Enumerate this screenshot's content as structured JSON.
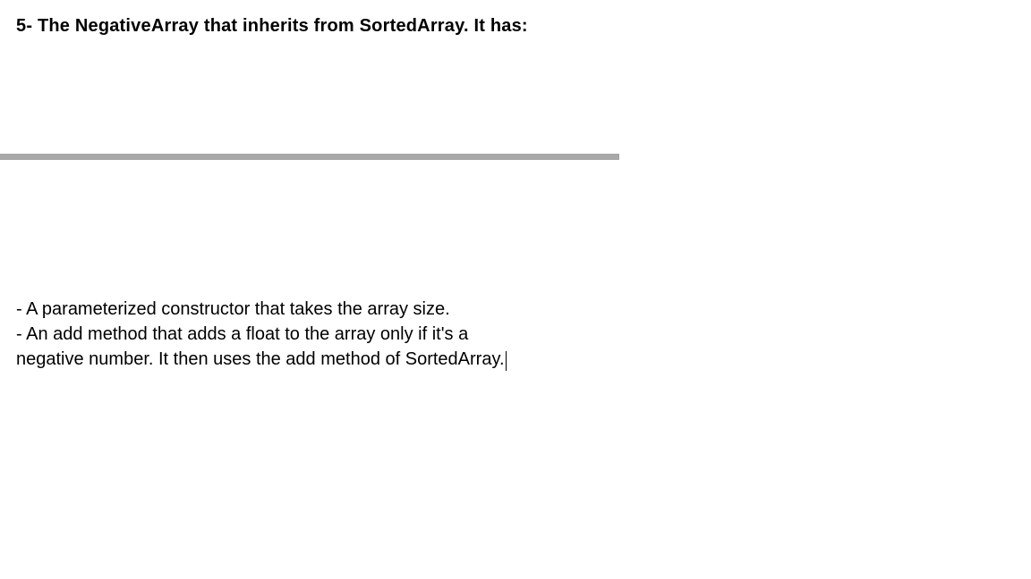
{
  "heading": "5- The NegativeArray that inherits from SortedArray. It has:",
  "body": {
    "line1": "- A parameterized constructor that takes the array size.",
    "line2": "- An add method that adds a float to the array only if it's a",
    "line3": "negative number. It then uses the add method of SortedArray."
  }
}
